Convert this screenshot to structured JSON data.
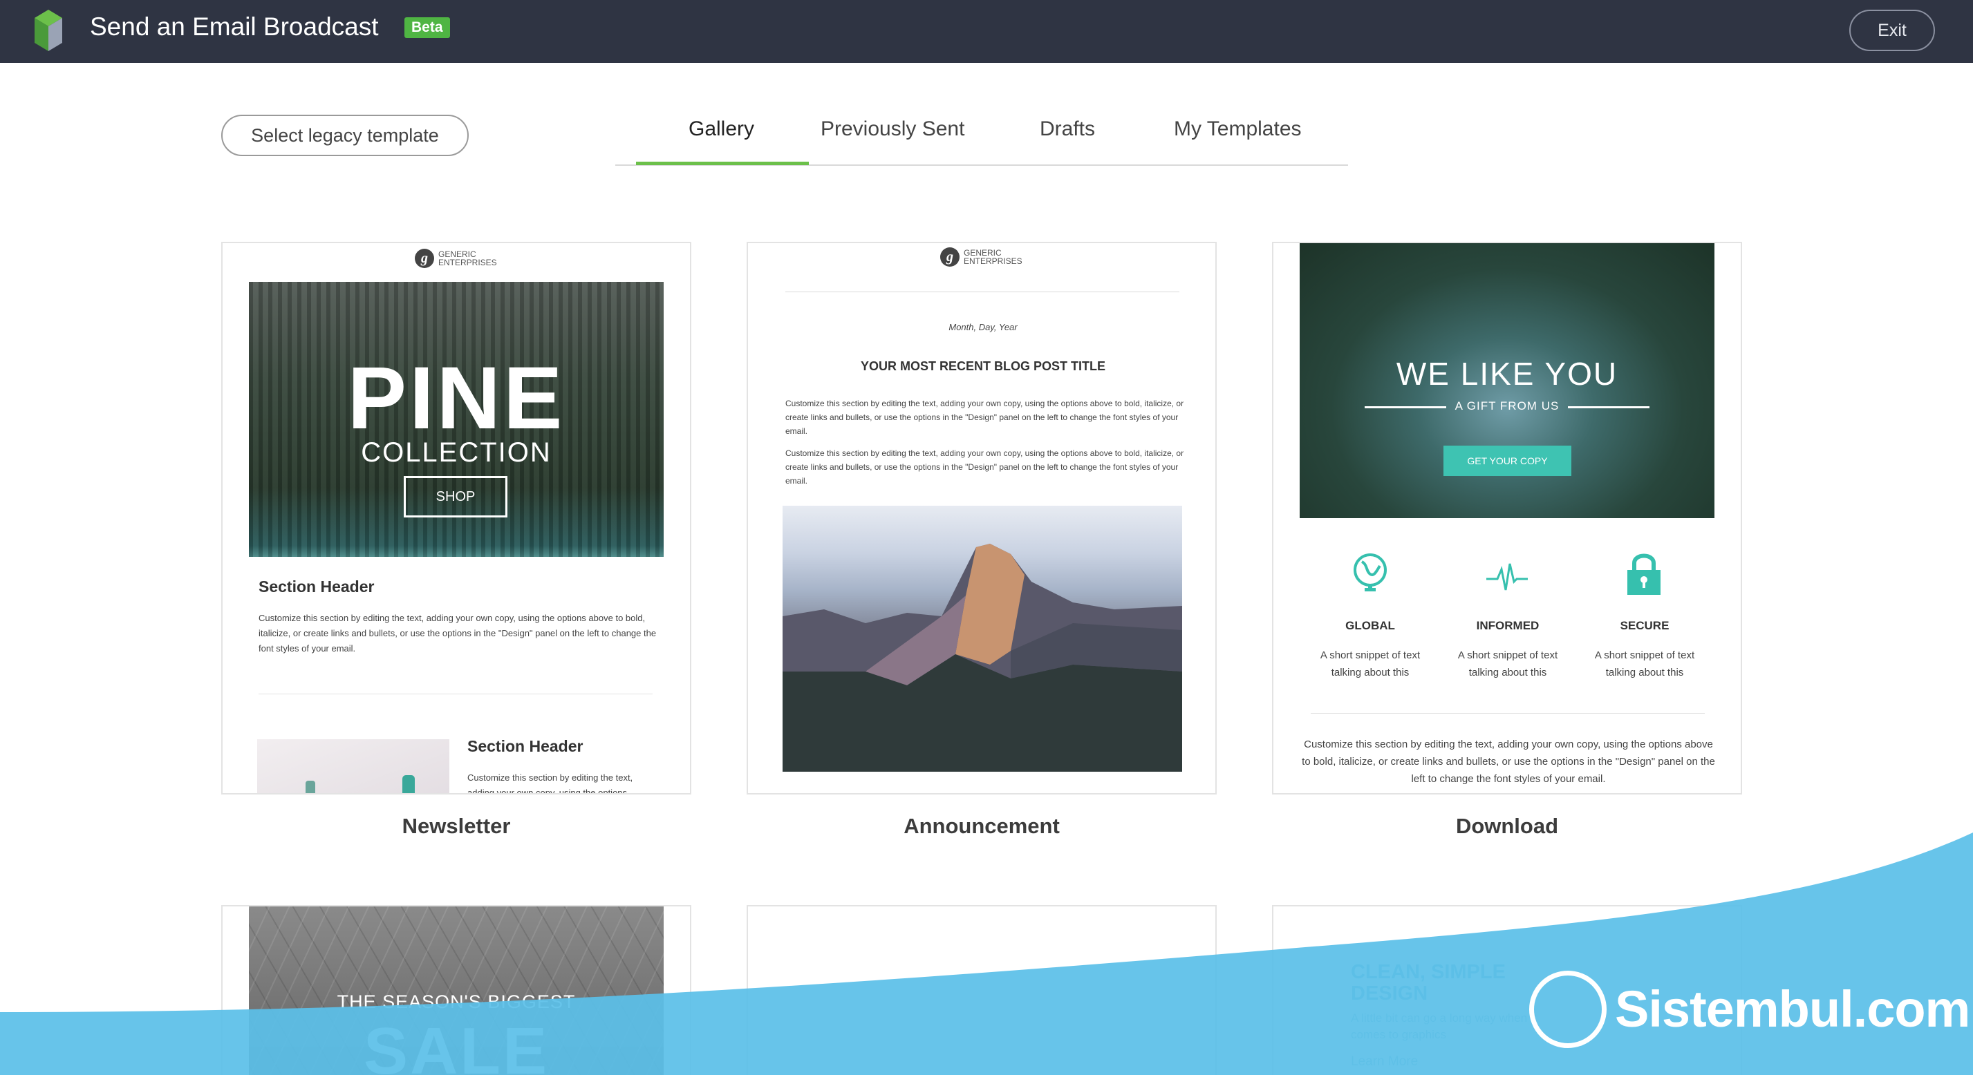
{
  "header": {
    "title": "Send an Email Broadcast",
    "badge": "Beta",
    "exit_label": "Exit"
  },
  "toolbar": {
    "legacy_label": "Select legacy template"
  },
  "tabs": [
    {
      "label": "Gallery",
      "active": true
    },
    {
      "label": "Previously Sent",
      "active": false
    },
    {
      "label": "Drafts",
      "active": false
    },
    {
      "label": "My Templates",
      "active": false
    }
  ],
  "brand": {
    "line1": "GENERIC",
    "line2": "ENTERPRISES"
  },
  "templates": [
    {
      "name": "Newsletter",
      "hero_title": "PINE",
      "hero_subtitle": "COLLECTION",
      "hero_button": "SHOP",
      "section_header": "Section Header",
      "section_text": "Customize this section by editing the text, adding your own copy, using the options above to bold, italicize, or create links and bullets, or use the options in the \"Design\" panel on the left to change the font styles of your email.",
      "section2_header": "Section Header",
      "section2_text": "Customize this section by editing the text, adding your own copy, using the options"
    },
    {
      "name": "Announcement",
      "date": "Month, Day, Year",
      "post_title": "YOUR MOST RECENT BLOG POST TITLE",
      "para1": "Customize this section by editing the text, adding your own copy, using the options above to bold, italicize, or create links and bullets, or use the options in the \"Design\" panel on the left to change the font styles of your email.",
      "para2": "Customize this section by editing the text, adding your own copy, using the options above to bold, italicize, or create links and bullets, or use the options in the \"Design\" panel on the left to change the font styles of your email."
    },
    {
      "name": "Download",
      "hero_title": "WE LIKE YOU",
      "hero_subtitle": "A GIFT FROM US",
      "hero_button": "GET YOUR COPY",
      "features": [
        {
          "icon": "globe-icon",
          "title": "GLOBAL",
          "text": "A short snippet of text talking about this"
        },
        {
          "icon": "pulse-icon",
          "title": "INFORMED",
          "text": "A short snippet of text talking about this"
        },
        {
          "icon": "lock-icon",
          "title": "SECURE",
          "text": "A short snippet of text talking about this"
        }
      ],
      "body": "Customize this section by editing the text, adding your own copy, using the options above to bold, italicize, or create links and bullets, or use the options in the \"Design\" panel on the left to change the font styles of your email."
    }
  ],
  "row2": {
    "sale_top": "THE SEASON'S BIGGEST",
    "sale_big": "SALE",
    "clean_title": "CLEAN, SIMPLE DESIGN",
    "clean_sub": "A little bit can go a long way when it comes to graphics",
    "clean_link": "Learn More"
  },
  "watermark": {
    "text": "Sistembul.com"
  },
  "colors": {
    "topbar": "#2f3443",
    "accent_green": "#6cc04a",
    "badge_green": "#4fb543",
    "teal": "#36c0ae",
    "wave_blue": "#5bbfe8"
  }
}
